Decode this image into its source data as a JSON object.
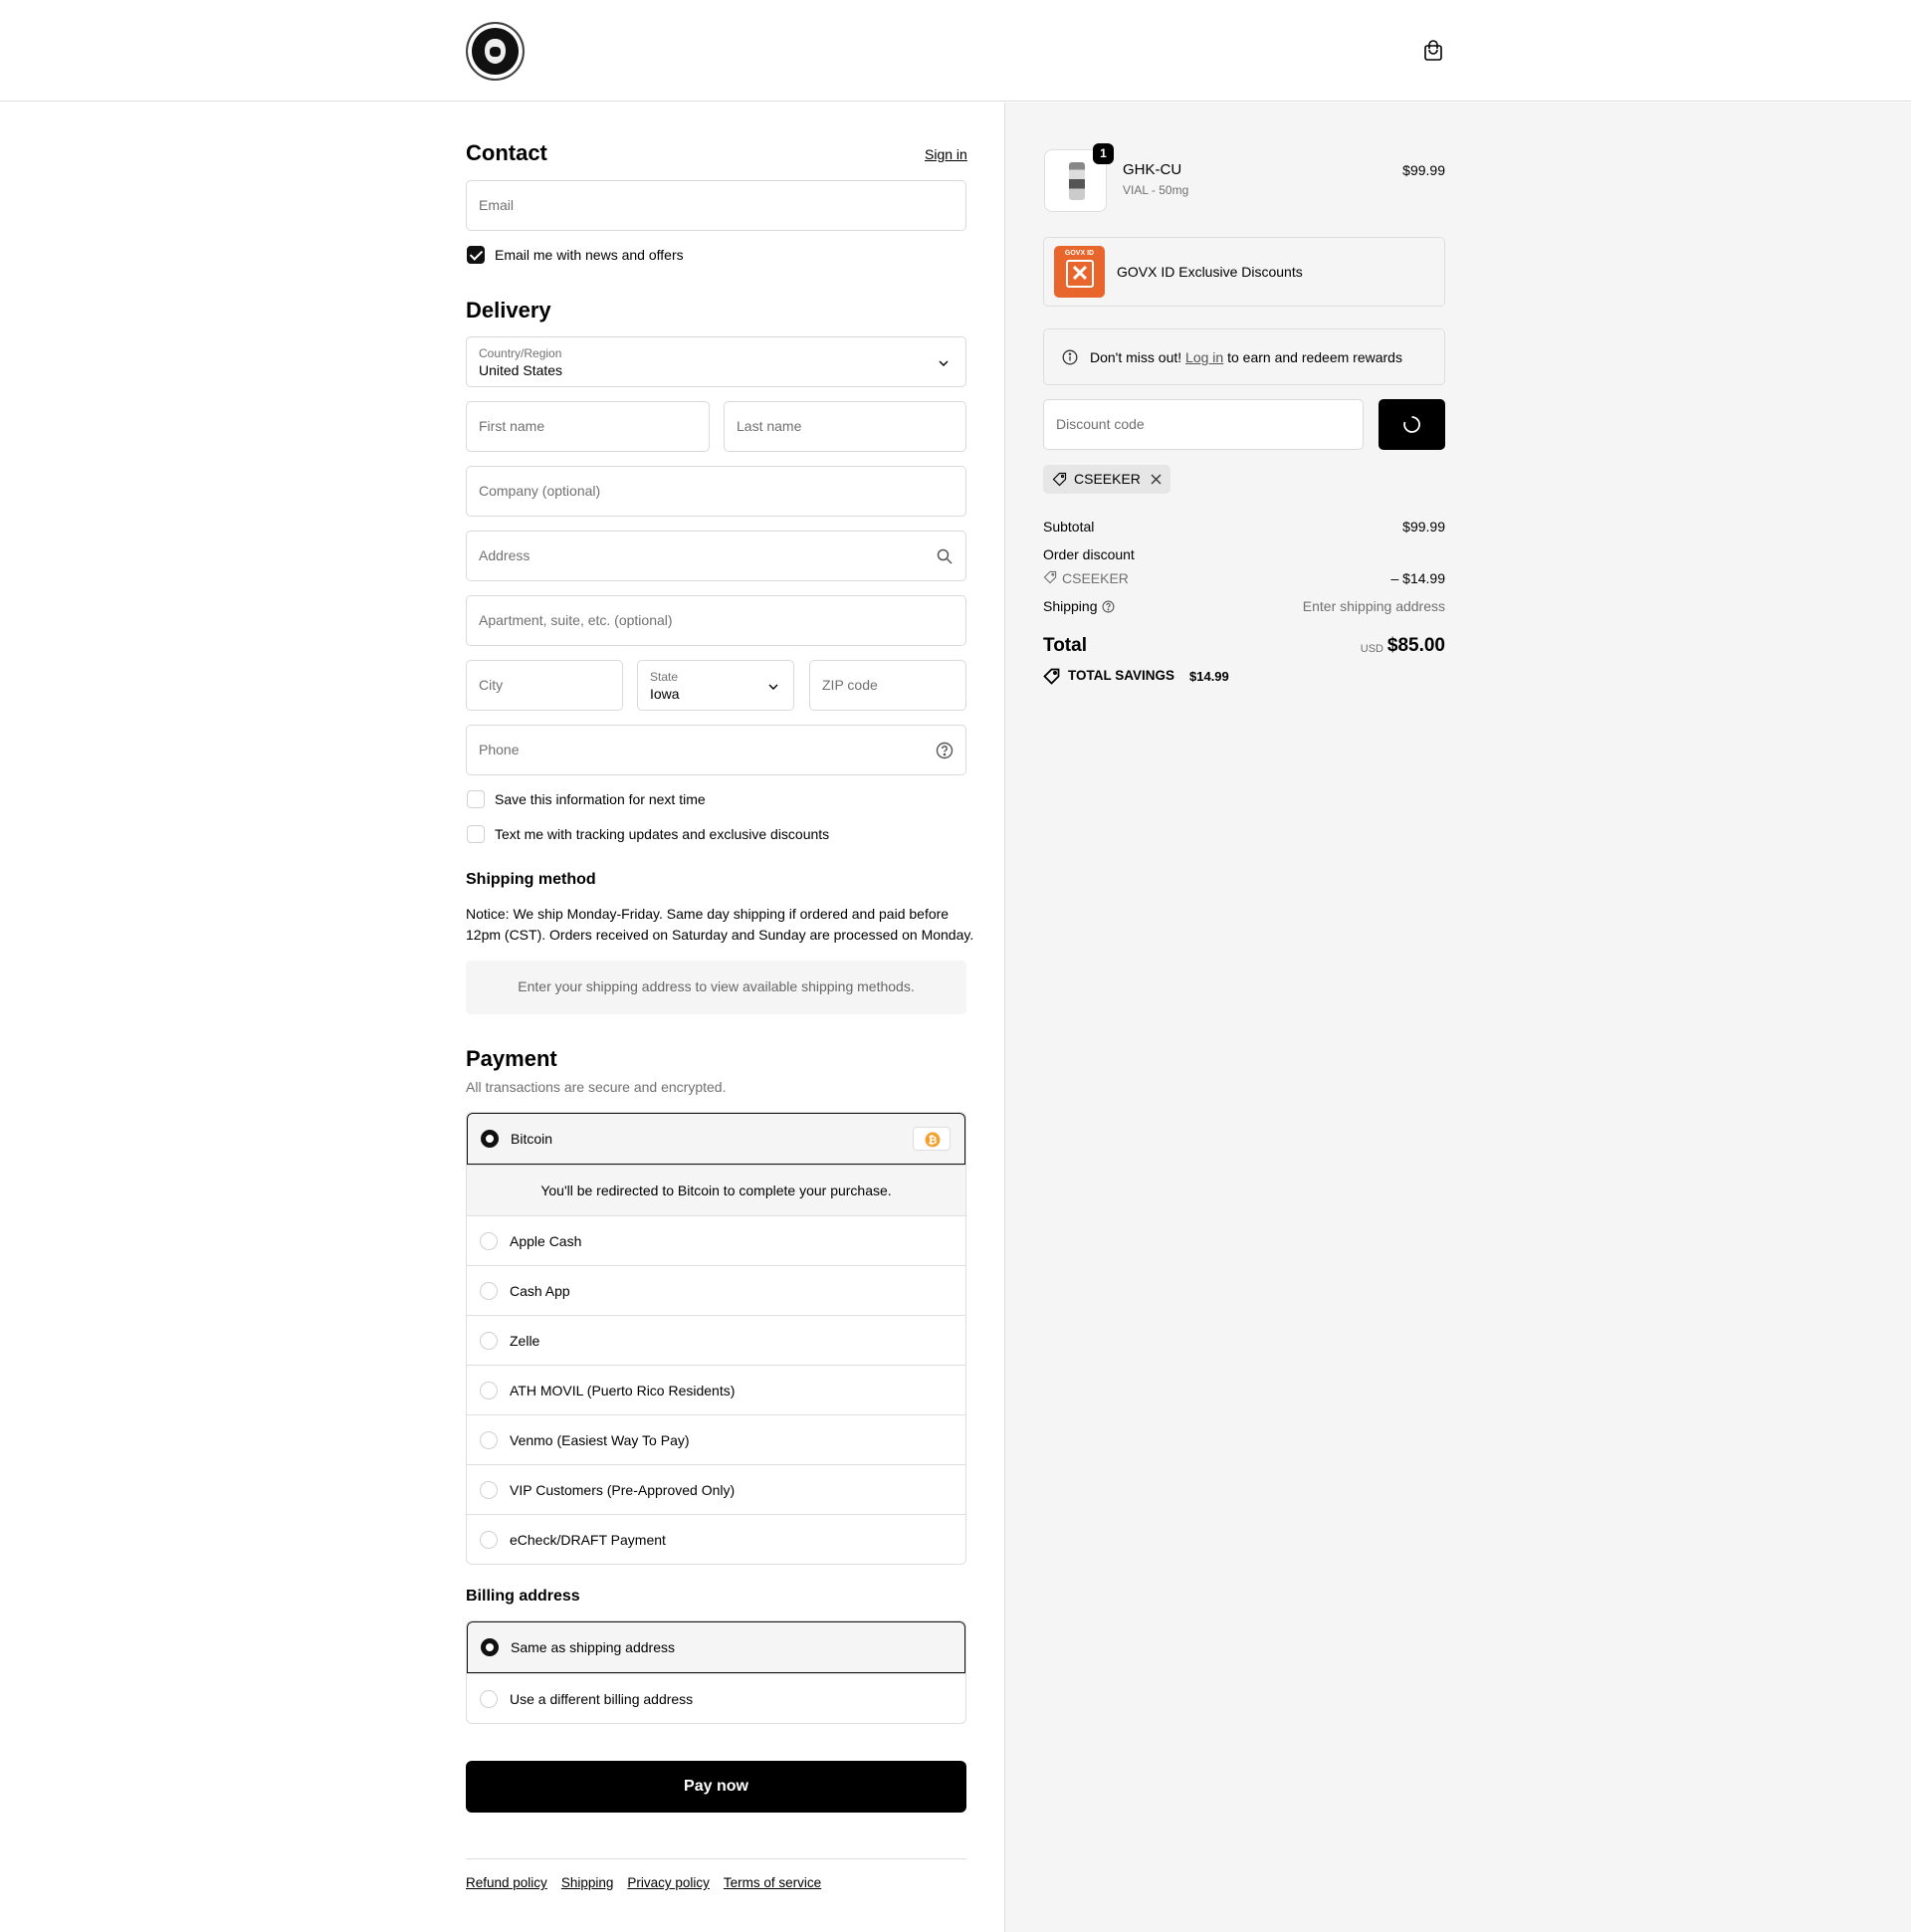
{
  "header": {
    "logo_name": "brand-logo",
    "cart_icon": "shopping-bag-icon"
  },
  "contact": {
    "title": "Contact",
    "sign_in": "Sign in",
    "email_placeholder": "Email",
    "news_label": "Email me with news and offers",
    "news_checked": true
  },
  "delivery": {
    "title": "Delivery",
    "country_label": "Country/Region",
    "country_value": "United States",
    "first_name_placeholder": "First name",
    "last_name_placeholder": "Last name",
    "company_placeholder": "Company (optional)",
    "address_placeholder": "Address",
    "apartment_placeholder": "Apartment, suite, etc. (optional)",
    "city_placeholder": "City",
    "state_label": "State",
    "state_value": "Iowa",
    "zip_placeholder": "ZIP code",
    "phone_placeholder": "Phone",
    "save_info_label": "Save this information for next time",
    "text_me_label": "Text me with tracking updates and exclusive discounts"
  },
  "shipping_method": {
    "title": "Shipping method",
    "notice_line1": "Notice: We ship Monday-Friday. Same day shipping if ordered and paid before",
    "notice_line2": "12pm (CST). Orders received on Saturday and Sunday are processed on Monday.",
    "empty_message": "Enter your shipping address to view available shipping methods."
  },
  "payment": {
    "title": "Payment",
    "subtitle": "All transactions are secure and encrypted.",
    "selected": "Bitcoin",
    "redirect_message": "You'll be redirected to Bitcoin to complete your purchase.",
    "options": [
      "Bitcoin",
      "Apple Cash",
      "Cash App",
      "Zelle",
      "ATH MOVIL (Puerto Rico Residents)",
      "Venmo (Easiest Way To Pay)",
      "VIP Customers (Pre-Approved Only)",
      "eCheck/DRAFT Payment"
    ]
  },
  "billing": {
    "title": "Billing address",
    "same_label": "Same as shipping address",
    "different_label": "Use a different billing address"
  },
  "pay_button": "Pay now",
  "footer": {
    "refund": "Refund policy",
    "shipping": "Shipping",
    "privacy": "Privacy policy",
    "terms": "Terms of service"
  },
  "order": {
    "quantity": "1",
    "product_name": "GHK-CU",
    "product_variant": "VIAL - 50mg",
    "product_price": "$99.99",
    "govx_logo_text": "GOVX ID",
    "govx_label": "GOVX ID Exclusive Discounts",
    "rewards_pre": "Don't miss out!",
    "rewards_link": "Log in",
    "rewards_post": "to earn and redeem rewards",
    "discount_placeholder": "Discount code",
    "applied_code": "CSEEKER",
    "subtotal_label": "Subtotal",
    "subtotal_value": "$99.99",
    "order_discount_label": "Order discount",
    "discount_code": "CSEEKER",
    "discount_value": "– $14.99",
    "shipping_label": "Shipping",
    "shipping_value": "Enter shipping address",
    "total_label": "Total",
    "currency": "USD",
    "total_value": "$85.00",
    "savings_label": "TOTAL SAVINGS",
    "savings_value": "$14.99"
  }
}
